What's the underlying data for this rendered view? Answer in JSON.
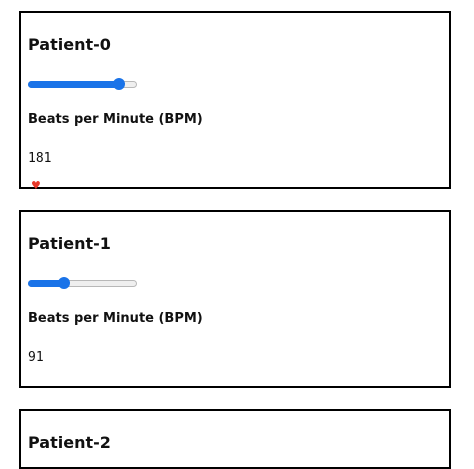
{
  "patients": [
    {
      "name": "Patient-0",
      "bpm_label": "Beats per Minute (BPM)",
      "bpm_value": "181",
      "slider_fraction": 0.85,
      "marker_icon": "heart-icon"
    },
    {
      "name": "Patient-1",
      "bpm_label": "Beats per Minute (BPM)",
      "bpm_value": "91",
      "slider_fraction": 0.34
    },
    {
      "name": "Patient-2"
    }
  ],
  "colors": {
    "slider_accent": "#1a73e8",
    "marker": "#e8392a",
    "border": "#000000"
  }
}
